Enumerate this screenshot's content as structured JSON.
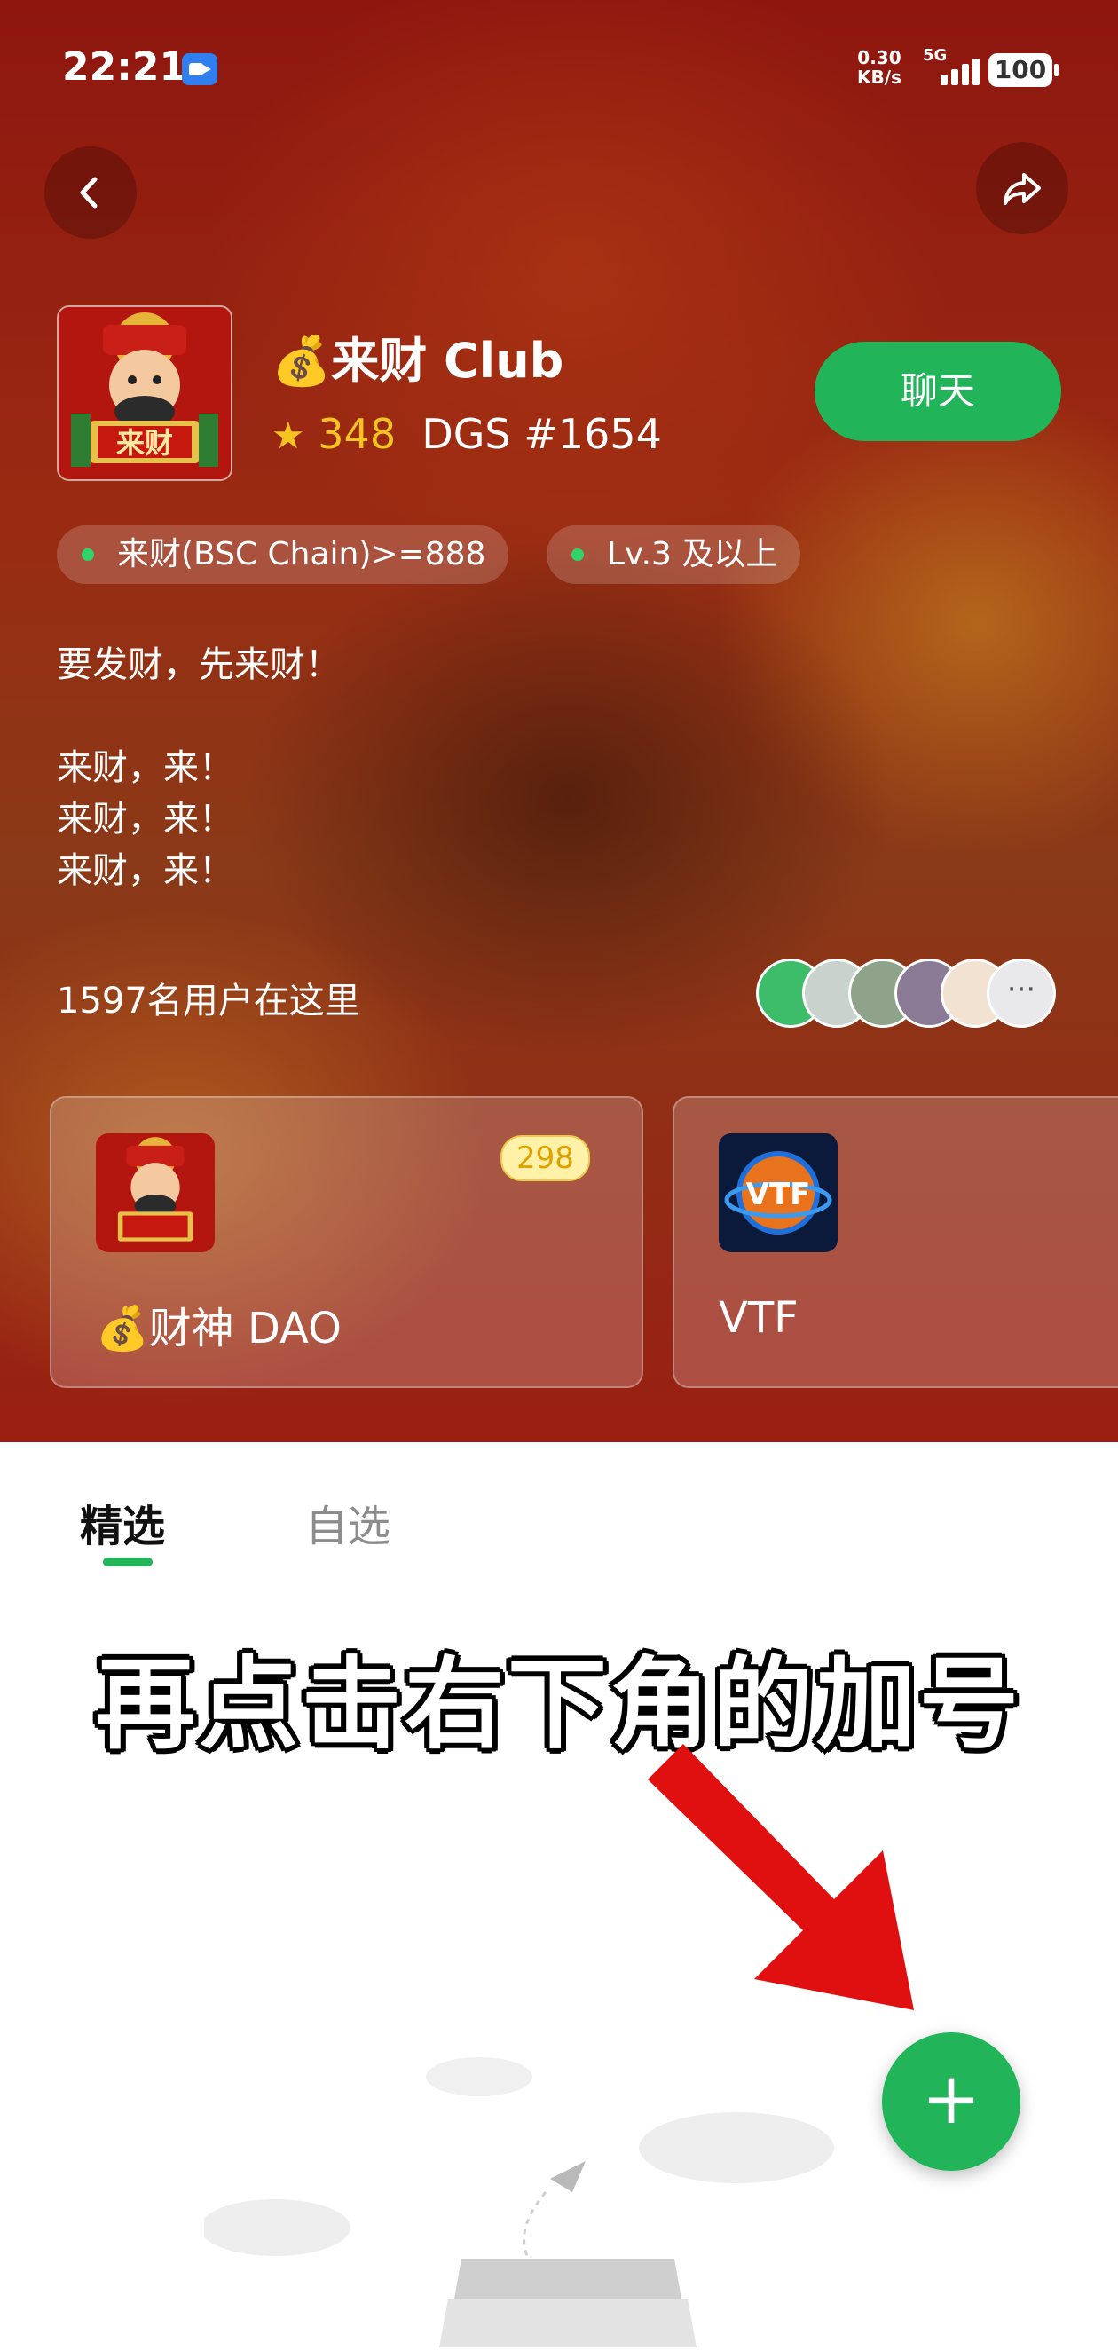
{
  "status_bar": {
    "time": "22:21",
    "net_speed_value": "0.30",
    "net_speed_unit": "KB/s",
    "network": "5G",
    "battery": "100"
  },
  "header": {
    "back_icon": "chevron-left-icon",
    "share_icon": "share-arrow-icon"
  },
  "club": {
    "emoji": "💰",
    "title": "来财 Club",
    "rating": "348",
    "token_id": "DGS #1654",
    "chat_label": "聊天",
    "requirements": [
      {
        "label": "来财(BSC Chain)>=888"
      },
      {
        "label": "Lv.3 及以上"
      }
    ],
    "description": "要发财，先来财！\n\n来财，来！\n来财，来！\n来财，来！",
    "user_count": "1597名用户在这里"
  },
  "communities": [
    {
      "name": "💰财神 DAO",
      "badge": "298"
    },
    {
      "name": "VTF",
      "badge": ""
    }
  ],
  "tabs": [
    {
      "label": "精选",
      "active": true
    },
    {
      "label": "自选",
      "active": false
    }
  ],
  "overlay": {
    "caption": "再点击右下角的加号"
  },
  "colors": {
    "accent": "#21b459",
    "hero_red": "#8e160f",
    "badge_yellow": "#f0c84a",
    "arrow_red": "#e01010"
  }
}
